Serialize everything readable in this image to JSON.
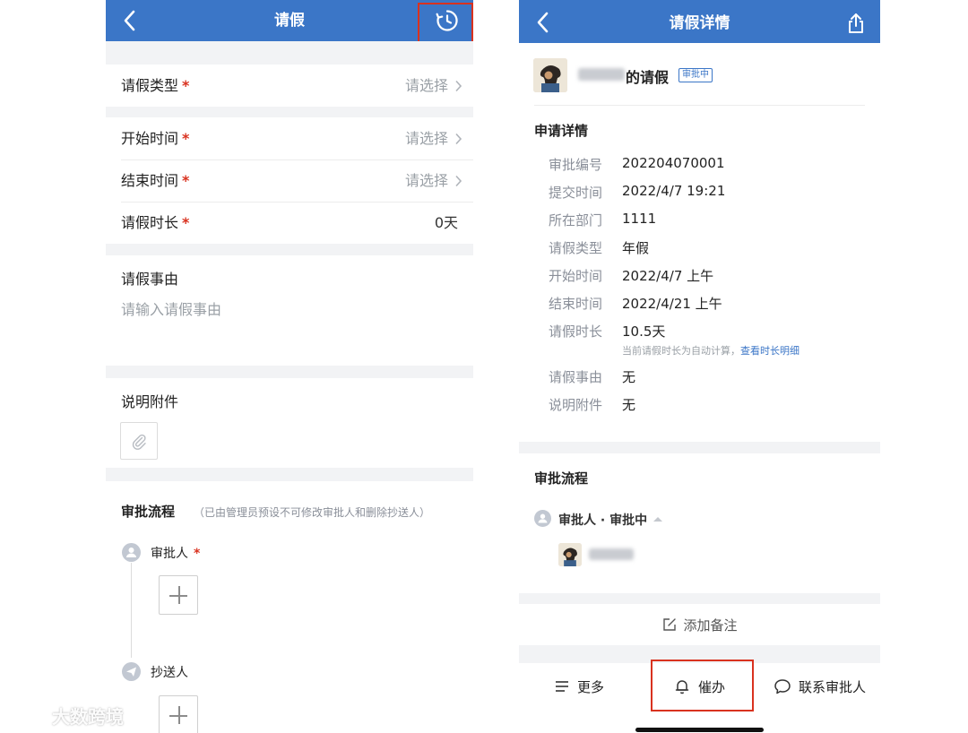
{
  "left": {
    "title": "请假",
    "leave_type": {
      "label": "请假类型",
      "required": "*",
      "placeholder": "请选择"
    },
    "start_time": {
      "label": "开始时间",
      "required": "*",
      "placeholder": "请选择"
    },
    "end_time": {
      "label": "结束时间",
      "required": "*",
      "placeholder": "请选择"
    },
    "duration": {
      "label": "请假时长",
      "required": "*",
      "value": "0天"
    },
    "reason": {
      "label": "请假事由",
      "placeholder": "请输入请假事由"
    },
    "attachment": {
      "label": "说明附件"
    },
    "flow": {
      "title": "审批流程",
      "note": "（已由管理员预设不可修改审批人和删除抄送人）",
      "approver_label": "审批人",
      "approver_required": "*",
      "cc_label": "抄送人"
    }
  },
  "right": {
    "title": "请假详情",
    "header": {
      "title_suffix": "的请假",
      "status": "审批中"
    },
    "details": {
      "title": "申请详情",
      "rows": [
        {
          "label": "审批编号",
          "value": "202204070001"
        },
        {
          "label": "提交时间",
          "value": "2022/4/7 19:21"
        },
        {
          "label": "所在部门",
          "value": "1111"
        },
        {
          "label": "请假类型",
          "value": "年假"
        },
        {
          "label": "开始时间",
          "value": "2022/4/7 上午"
        },
        {
          "label": "结束时间",
          "value": "2022/4/21 上午"
        },
        {
          "label": "请假时长",
          "value": "10.5天"
        },
        {
          "label": "请假事由",
          "value": "无"
        },
        {
          "label": "说明附件",
          "value": "无"
        }
      ],
      "duration_hint": "当前请假时长为自动计算，",
      "duration_link": "查看时长明细"
    },
    "flow": {
      "title": "审批流程",
      "step": "审批人 · 审批中"
    },
    "add_remark": "添加备注",
    "toolbar": {
      "more": "更多",
      "urge": "催办",
      "contact": "联系审批人"
    }
  },
  "watermark": {
    "text": "大数跨境"
  },
  "colors": {
    "nav_blue": "#3b76c7",
    "required_red": "#d9321f",
    "highlight_red": "#d9321f",
    "gap_gray": "#f2f3f5"
  }
}
